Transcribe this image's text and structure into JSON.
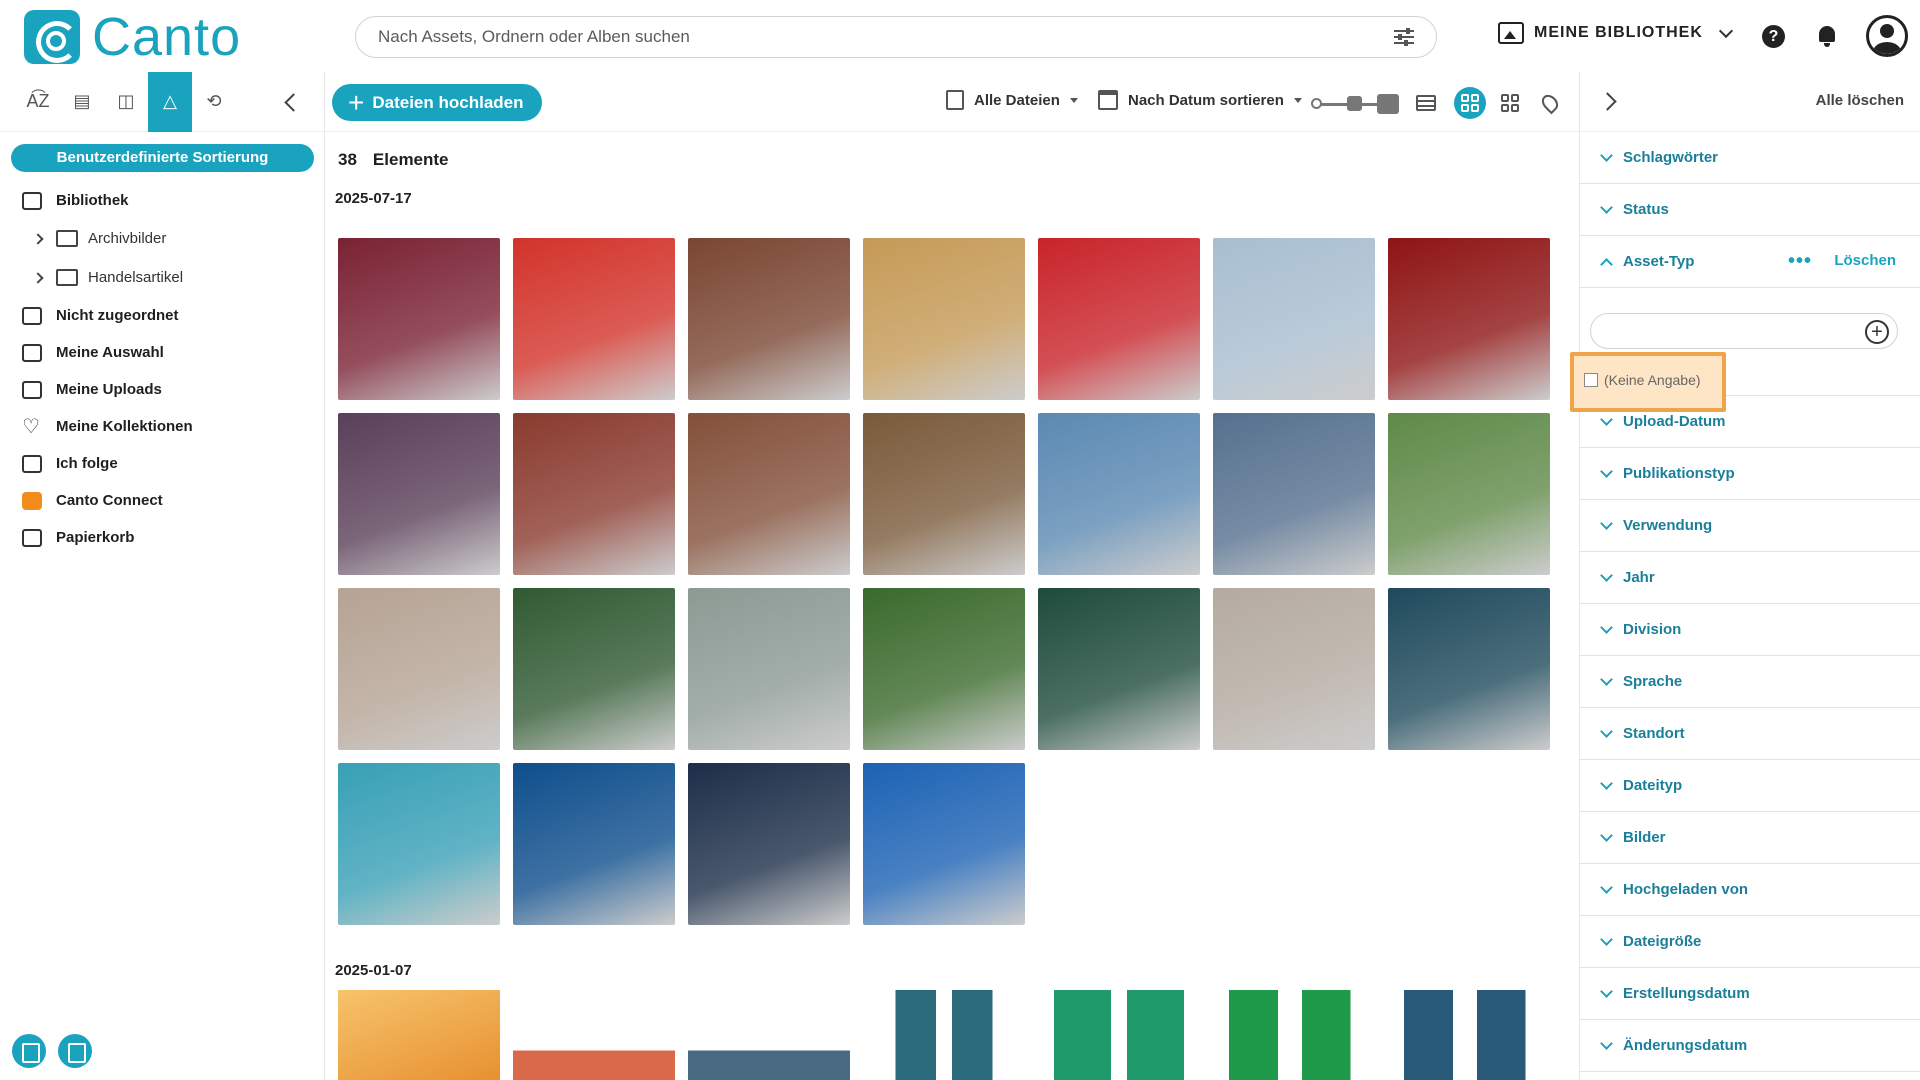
{
  "header": {
    "logo_text": "Canto",
    "search_placeholder": "Nach Assets, Ordnern oder Alben suchen",
    "library_label": "MEINE BIBLIOTHEK",
    "help_symbol": "?"
  },
  "left_sidebar": {
    "view_tabs": [
      "AZ",
      "calendar",
      "gallery",
      "shapes",
      "sync"
    ],
    "sort_label": "Benutzerdefinierte Sortierung",
    "library": "Bibliothek",
    "folders": [
      "Archivbilder",
      "Handelsartikel"
    ],
    "items": [
      "Nicht zugeordnet",
      "Meine Auswahl",
      "Meine Uploads",
      "Meine Kollektionen",
      "Ich folge",
      "Canto Connect",
      "Papierkorb"
    ]
  },
  "toolbar": {
    "upload_label": "Dateien hochladen",
    "all_files": "Alle Dateien",
    "sort_by": "Nach Datum sortieren"
  },
  "main": {
    "count": "38",
    "count_label": "Elemente",
    "date1": "2025-07-17",
    "date2": "2025-01-07",
    "thumbs": [
      "#7a2234",
      "#d2332a",
      "#7a4632",
      "#c59a56",
      "#c8242a",
      "#a8bed0",
      "#8e1414",
      "#5a3f58",
      "#8a3a2e",
      "#83503a",
      "#7a5a3a",
      "#5b89b2",
      "#55708e",
      "#5f8a48",
      "#b5a394",
      "#305a32",
      "#8c9a94",
      "#3a6a2c",
      "#1e4b3c",
      "#b4aaa0",
      "#1f4a5c",
      "#38a0b6",
      "#0e4e8c",
      "#1c2e48",
      "#1c62b4"
    ],
    "thumbs2": [
      "#e9a33c",
      "#d86a4a",
      "#4a6a84",
      "#ffffff",
      "#ffffff",
      "#ffffff",
      "#ffffff"
    ]
  },
  "right_panel": {
    "clear_all": "Alle löschen",
    "filters_top": [
      "Schlagwörter",
      "Status"
    ],
    "asset_type": "Asset-Typ",
    "delete_label": "Löschen",
    "dots": "•••",
    "option": "(Keine Angabe)",
    "filters_bottom": [
      "Upload-Datum",
      "Publikationstyp",
      "Verwendung",
      "Jahr",
      "Division",
      "Sprache",
      "Standort",
      "Dateityp",
      "Bilder",
      "Hochgeladen von",
      "Dateigröße",
      "Erstellungsdatum",
      "Änderungsdatum"
    ]
  }
}
